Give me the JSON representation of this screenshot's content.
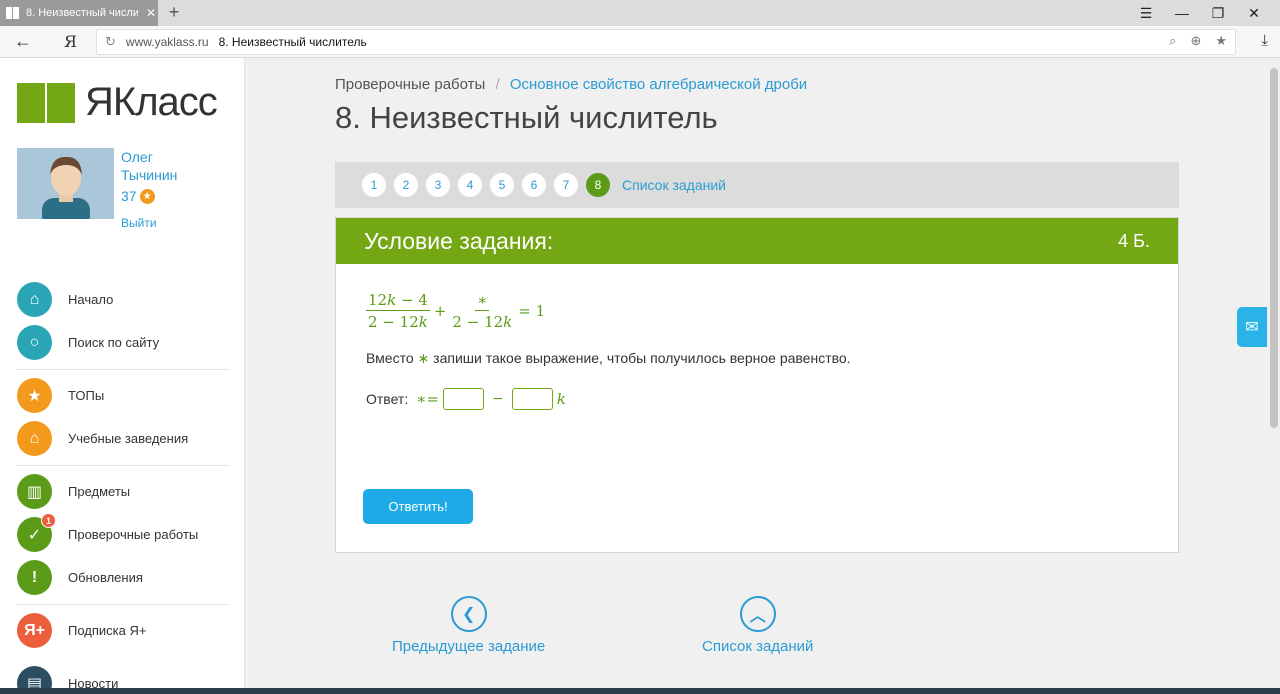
{
  "browser": {
    "tab_title": "8. Неизвестный числитель",
    "new_tab_icon": "plus-icon",
    "url_domain": "www.yaklass.ru",
    "url_title": "8. Неизвестный числитель",
    "yandex_label": "Я"
  },
  "sidebar": {
    "logo_text": "ЯКласс",
    "user_first_name": "Олег",
    "user_last_name": "Тычинин",
    "user_points": "37",
    "logout_label": "Выйти",
    "menu": [
      {
        "label": "Начало",
        "icon": "home-icon"
      },
      {
        "label": "Поиск по сайту",
        "icon": "search-icon"
      },
      {
        "label": "ТОПы",
        "icon": "star-icon"
      },
      {
        "label": "Учебные заведения",
        "icon": "institution-icon"
      },
      {
        "label": "Предметы",
        "icon": "book-icon"
      },
      {
        "label": "Проверочные работы",
        "icon": "check-icon",
        "badge": "1"
      },
      {
        "label": "Обновления",
        "icon": "exclamation-icon"
      },
      {
        "label": "Подписка Я+",
        "icon": "ya-plus-icon"
      },
      {
        "label": "Новости",
        "icon": "news-icon"
      }
    ]
  },
  "main": {
    "breadcrumb_root": "Проверочные работы",
    "breadcrumb_separator": "/",
    "breadcrumb_link": "Основное свойство алгебраической дроби",
    "page_title": "8. Неизвестный числитель",
    "task_numbers": [
      "1",
      "2",
      "3",
      "4",
      "5",
      "6",
      "7",
      "8"
    ],
    "active_task": "8",
    "task_list_link": "Список заданий"
  },
  "task": {
    "header_title": "Условие задания:",
    "header_points": "4 Б.",
    "formula": {
      "frac1_num_a": "12",
      "frac1_num_var": "k",
      "frac1_num_b": " − 4",
      "frac1_den_a": "2 − 12",
      "frac1_den_var": "k",
      "plus": "+",
      "frac2_num": "∗",
      "frac2_den_a": "2 − 12",
      "frac2_den_var": "k",
      "equals": "= 1"
    },
    "instruction_before": "Вместо ",
    "instruction_star": "∗",
    "instruction_after": " запиши такое выражение, чтобы получилось верное равенство.",
    "answer_label": "Ответ:",
    "answer_prefix": "∗=",
    "answer_minus": "−",
    "answer_suffix": "k",
    "submit_label": "Ответить!"
  },
  "footer_nav": {
    "prev_label": "Предыдущее задание",
    "list_label": "Список заданий"
  },
  "colors": {
    "brand_green": "#73a814",
    "link_blue": "#2b9bd3",
    "button_blue": "#1eaae7"
  }
}
